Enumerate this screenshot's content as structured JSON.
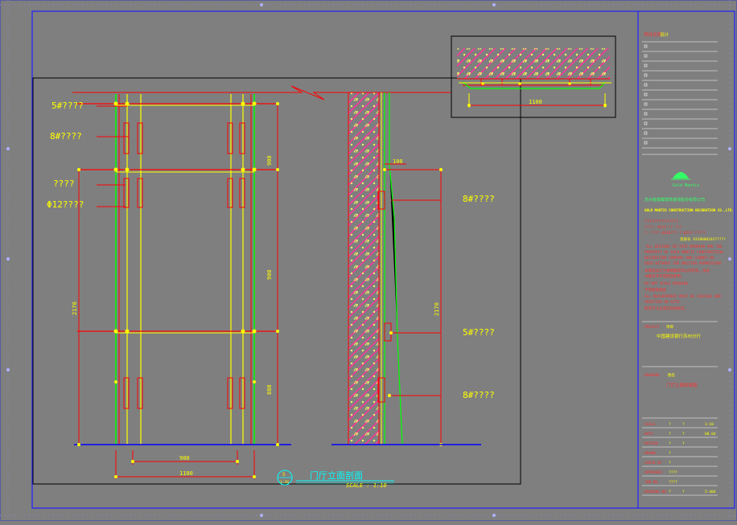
{
  "colors": {
    "background": "#7f7f7f",
    "frame": "#1a1aff",
    "line_red": "#ff0000",
    "line_green": "#00ff00",
    "line_yellow": "#ffff00",
    "text_yellow": "#ffff00",
    "text_red": "#ff3333",
    "text_cyan": "#00ffff",
    "hatch_magenta": "#ff33ff"
  },
  "elevation": {
    "callouts": [
      "5#????",
      "8#????",
      "????",
      "Φ12????"
    ],
    "dims": {
      "right_top": "900",
      "right_mid": "900",
      "right_bottom": "880",
      "overall_height": "2170",
      "inner_width": "900",
      "overall_width": "1100"
    }
  },
  "section": {
    "callouts": [
      "8#????",
      "5#????",
      "8#????"
    ],
    "dims": {
      "top": "100",
      "height": "2170"
    }
  },
  "plan_detail": {
    "dim": "1100"
  },
  "caption": {
    "marker_top": "5",
    "marker_bottom": "1:20",
    "title": "门厅立面剖面",
    "scale": "SCALE : 1:10"
  },
  "title_block": {
    "header_label": "项目名称",
    "header_value": "设计",
    "logo_text": "Gold Mantis",
    "company_cn": "苏州金螳螂建筑装饰股份有限公司",
    "company_en": "GOLD MANTIS CONSTRUCTION DECORATION CO.,LTD.",
    "company_line3": "??????????????",
    "addr_line1": "????: 0512-?? ???",
    "addr_line2": "?: ????-6828??? ?:0512-?????",
    "cert_line": "资质号 A3200001017????",
    "copy_lines": [
      "ALL DESIGNS IN THIS DRAWING ARE THE",
      "PROPERTY OF GOLD MANTIS CONSTRUCTION",
      "DECORATION COMPANY AND CANNOT BE",
      "USED WITHOUT THE WRITTEN PERMISSION",
      "本图纸设计为金螳螂装饰公司所有，未经",
      "书面许可不得擅自使用。",
      "DO NOT SCALE DRAWING",
      "不得量取图纸",
      "ALL MEASUREMENT MUST BE CHECKED AND",
      "VERIFIED ON SITE.",
      "所有尺寸必须在现场核实。"
    ],
    "project_label": "PROJECT",
    "project_label_cn": "项目",
    "project_name": "中国建设银行苏州分行",
    "drawing_label": "DRAWING",
    "drawing_label_cn": "图名",
    "drawing_name": "门厅立面剖面图",
    "rows": [
      {
        "label": "SCALE",
        "v1": "?",
        "v2": "?",
        "v3": "1:10"
      },
      {
        "label": "DATE",
        "v1": "?",
        "v2": "?",
        "v3": "08.04"
      },
      {
        "label": "DESIGN",
        "v1": "?",
        "v2": "?",
        "v3": ""
      },
      {
        "label": "DRAWN",
        "v1": "?",
        "v2": "",
        "v3": ""
      },
      {
        "label": "CHECK BY",
        "v1": "?",
        "v2": "",
        "v3": ""
      },
      {
        "label": "APPROVED",
        "v1": "????",
        "v2": "",
        "v3": ""
      },
      {
        "label": "JOB NO.",
        "v1": "????",
        "v2": "",
        "v3": ""
      },
      {
        "label": "DRAWING NO.",
        "v1": "?",
        "v2": "?",
        "v3": "5-404"
      }
    ]
  }
}
